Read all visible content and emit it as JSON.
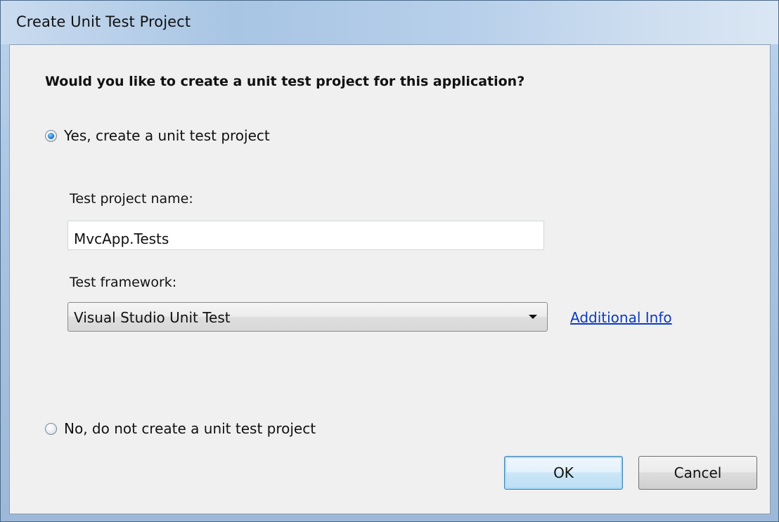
{
  "window": {
    "title": "Create Unit Test Project"
  },
  "dialog": {
    "question": "Would you like to create a unit test project for this application?",
    "options": [
      {
        "label": "Yes, create a unit test project",
        "selected": true
      },
      {
        "label": "No, do not create a unit test project",
        "selected": false
      }
    ],
    "project_name": {
      "label": "Test project name:",
      "value": "MvcApp.Tests"
    },
    "framework": {
      "label": "Test framework:",
      "selected": "Visual Studio Unit Test"
    },
    "additional_info_link": "Additional Info",
    "buttons": {
      "ok": "OK",
      "cancel": "Cancel"
    }
  }
}
